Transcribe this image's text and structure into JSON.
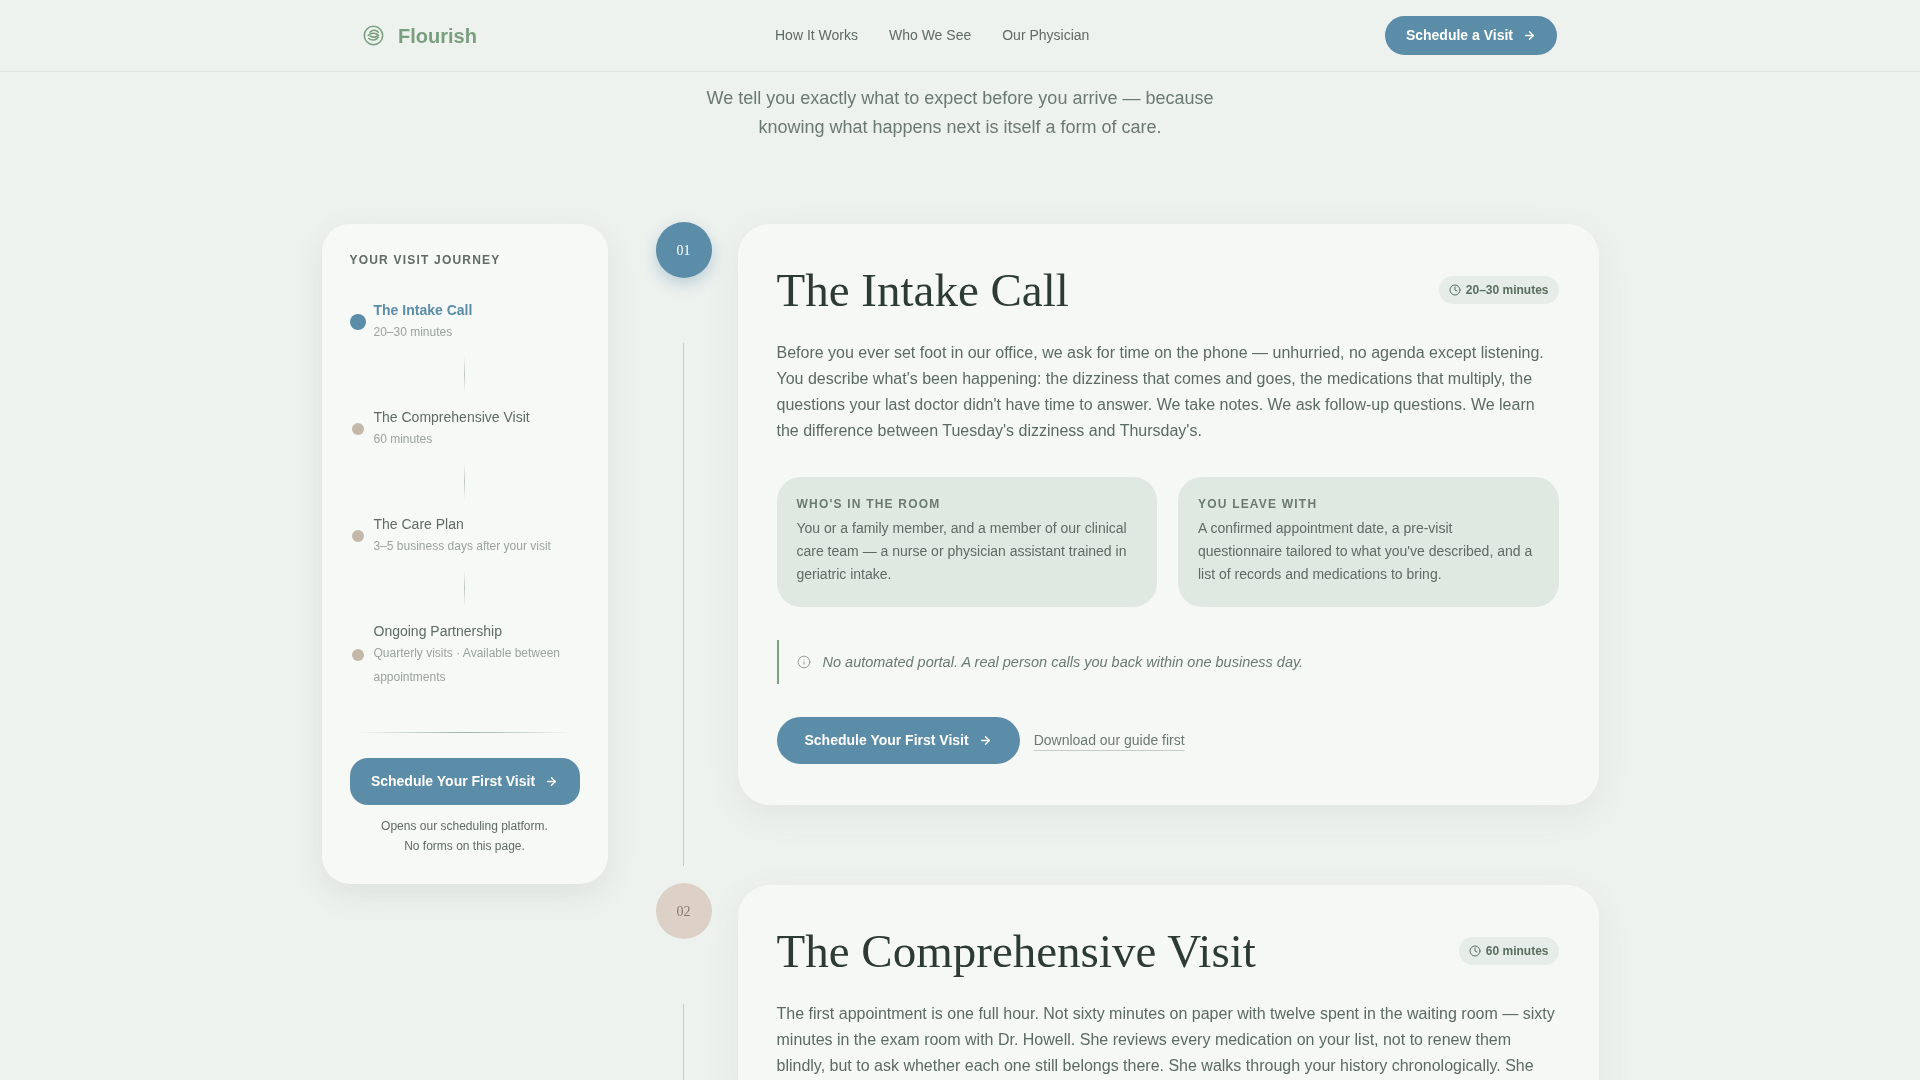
{
  "header": {
    "brand": "Flourish",
    "nav": [
      "How It Works",
      "Who We See",
      "Our Physician"
    ],
    "cta": "Schedule a Visit"
  },
  "intro": "We tell you exactly what to expect before you arrive — because knowing what happens next is itself a form of care.",
  "journey": {
    "title": "YOUR VISIT JOURNEY",
    "steps": [
      {
        "title": "The Intake Call",
        "detail": "20–30 minutes",
        "selected": true
      },
      {
        "title": "The Comprehensive Visit",
        "detail": "60 minutes",
        "selected": false
      },
      {
        "title": "The Care Plan",
        "detail": "3–5 business days after your visit",
        "selected": false
      },
      {
        "title": "Ongoing Partnership",
        "detail": "Quarterly visits · Available between appointments",
        "selected": false
      }
    ],
    "cta": "Schedule Your First Visit",
    "note": [
      "Opens our scheduling platform.",
      "No forms on this page."
    ]
  },
  "steps": [
    {
      "number": "01",
      "active": true,
      "title": "The Intake Call",
      "duration": "20–30 minutes",
      "body": "Before you ever set foot in our office, we ask for time on the phone — unhurried, no agenda except listening. You describe what's been happening: the dizziness that comes and goes, the medications that multiply, the questions your last doctor didn't have time to answer. We take notes. We ask follow-up questions. We learn the difference between Tuesday's dizziness and Thursday's.",
      "details": [
        {
          "label": "WHO'S IN THE ROOM",
          "text": "You or a family member, and a member of our clinical care team — a nurse or physician assistant trained in geriatric intake."
        },
        {
          "label": "YOU LEAVE WITH",
          "text": "A confirmed appointment date, a pre-visit questionnaire tailored to what you've described, and a list of records and medications to bring."
        }
      ],
      "note": "No automated portal. A real person calls you back within one business day.",
      "actions": [
        {
          "kind": "primary",
          "label": "Schedule Your First Visit"
        },
        {
          "kind": "link",
          "label": "Download our guide first"
        }
      ]
    },
    {
      "number": "02",
      "active": false,
      "title": "The Comprehensive Visit",
      "duration": "60 minutes",
      "body": "The first appointment is one full hour. Not sixty minutes on paper with twelve spent in the waiting room — sixty minutes in the exam room with Dr. Howell. She reviews every medication on your list, not to renew them blindly, but to ask whether each one still belongs there. She walks through your history chronologically. She"
    }
  ]
}
